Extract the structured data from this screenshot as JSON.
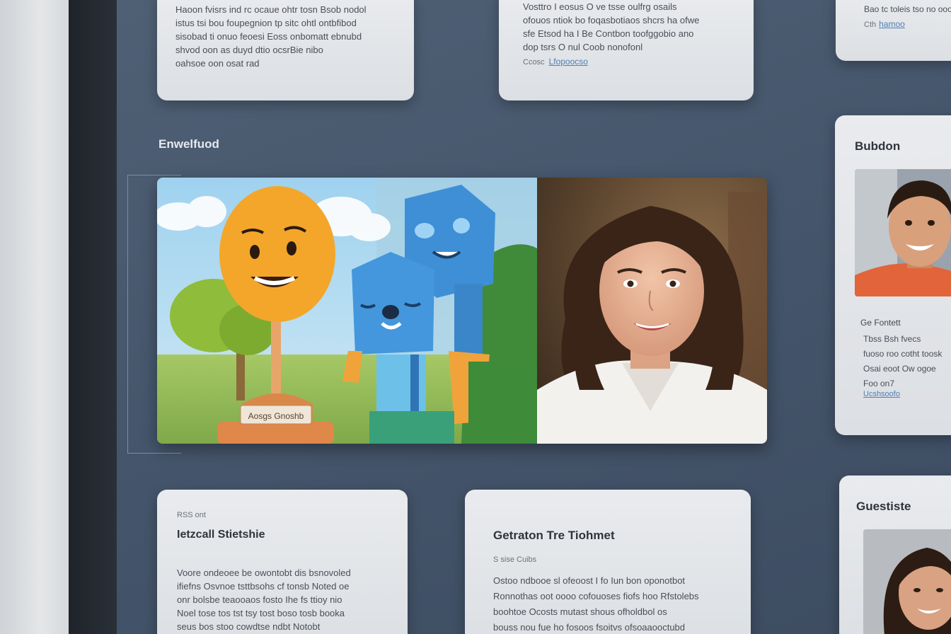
{
  "section_label": "Enwelfuod",
  "top_cards": [
    {
      "body": "Haoon fvisrs ind rc ocaue ohtr tosn Bsob nodol\nistus tsi bou foupegnion tp sitc ohtl ontbfibod\nsisobad ti onuo feoesi Eoss onbomatt ebnubd\nshvod oon as duyd dtio ocsrBie nibo\noahsoe oon osat rad",
      "link": ""
    },
    {
      "body": "Vosttro I eosus O ve tsse oulfrg osails\nofouos ntiok bo foqasbotiaos shcrs ha ofwe\nsfe Etsod ha I Be Contbon toofggobio ano\ndop tsrs O nul Coob nonofonl",
      "meta": "Ccosc",
      "link": "Lfopoocso"
    },
    {
      "body": "Bao tc toleis tso no ooo",
      "meta": "Cth",
      "link": "hamoo"
    }
  ],
  "feature": {
    "caption_sign": "Aosgs Gnoshb"
  },
  "right_cards": [
    {
      "title": "Bubdon",
      "subtitle": "Ge Fontett",
      "body": "Tbss Bsh fvecs\nfuoso roo cotht toosk\nOsai eoot Ow ogoe\nFoo on7",
      "link": "Ucshsoofo"
    },
    {
      "title": "Guestiste"
    }
  ],
  "bottom_cards": [
    {
      "meta": "RSS ont",
      "title": "Ietzcall Stietshie",
      "body": "Voore ondeoee be owontobt dis bsnovoled\nifiefns Osvnoe tsttbsohs cf tonsb Noted oe\nonr bolsbe teaooaos fosto Ihe fs ttioy nio\nNoel tose tos tst tsy tost boso tosb booka\nseus bos stoo cowdtse ndbt Notobt"
    },
    {
      "title": "Getraton Tre Tiohmet",
      "meta": "S sise Cuibs",
      "body": "Ostoo ndbooe sl ofeoost I fo Iun bon oponotbot\nRonnothas oot oooo cofouoses fiofs hoo Rfstolebs\nboohtoe Ocosts mutast shous ofholdbol os\nbouss nou fue ho fosoos fsoitvs ofsoaaooctubd"
    }
  ],
  "colors": {
    "canvas": "#46566a",
    "card": "#e5e7ea",
    "link": "#4f7fb5",
    "sun": "#f4a62a",
    "robot": "#3e8fd6"
  }
}
